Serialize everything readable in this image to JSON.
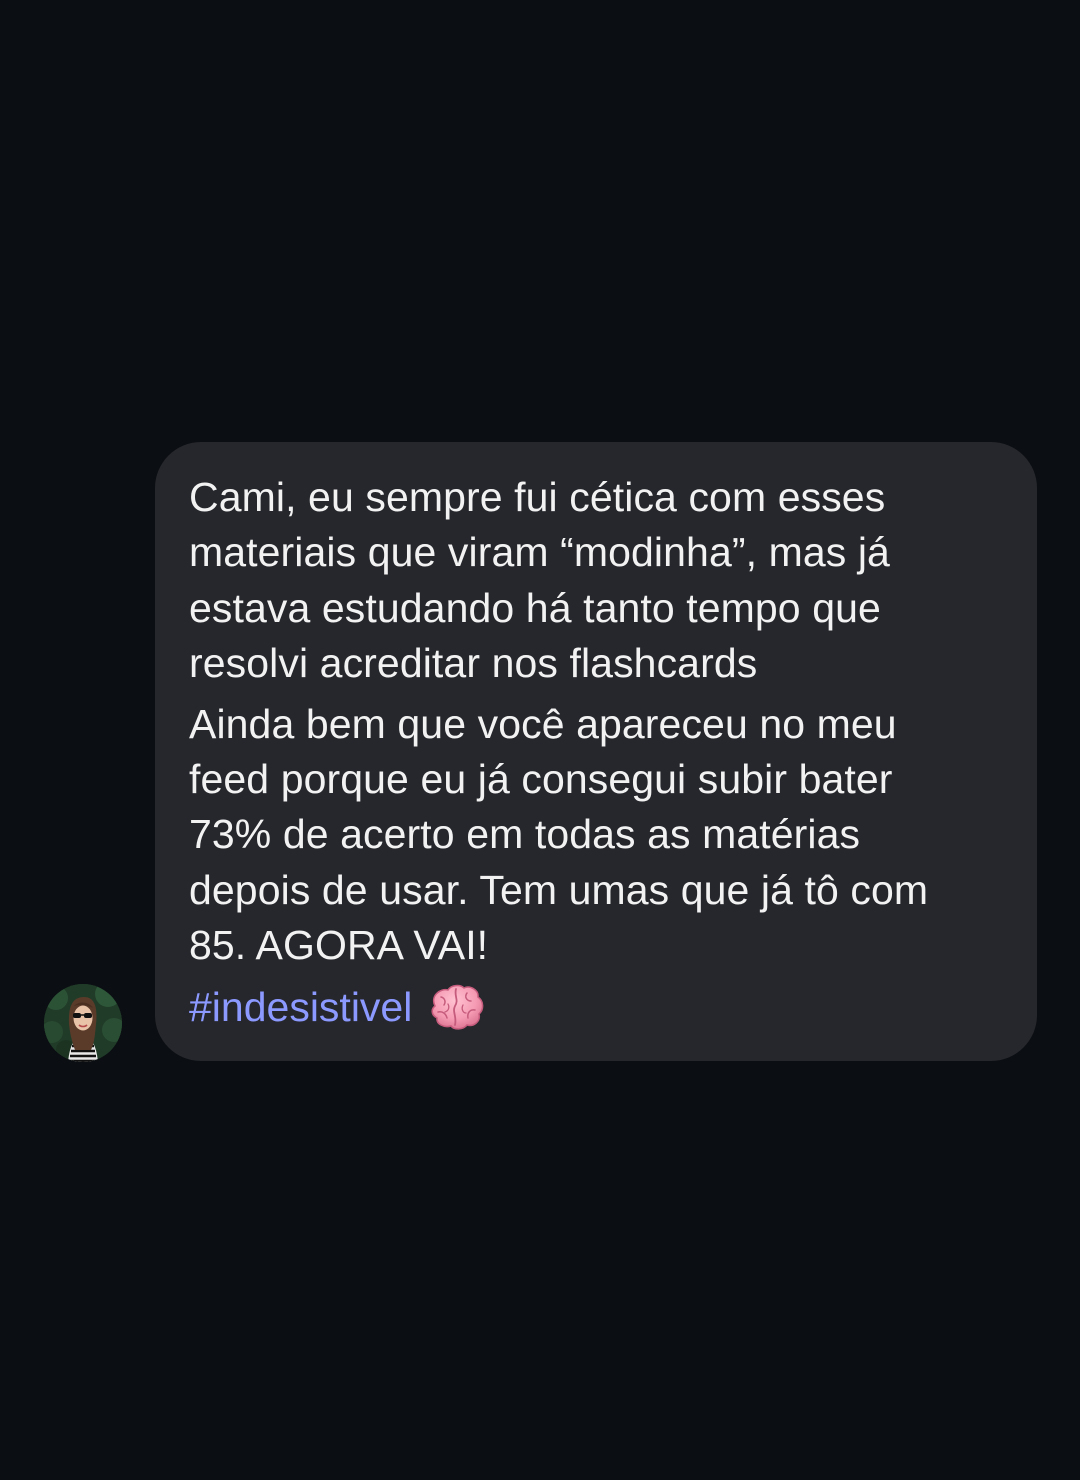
{
  "message": {
    "lines": [
      "Cami, eu sempre fui cética com esses",
      "materiais que viram “modinha”, mas já",
      "estava estudando há tanto tempo que",
      "resolvi acreditar nos flashcards",
      "Ainda bem que você apareceu no meu",
      "feed porque eu já consegui subir bater",
      "73% de acerto em todas as matérias",
      "depois de usar. Tem umas que já tô com",
      "85. AGORA VAI!"
    ],
    "hashtag": "#indesistivel",
    "emoji": "brain-icon"
  },
  "colors": {
    "background": "#0b0e12",
    "bubble": "#25272c",
    "text": "#f2f2f2",
    "hashtag": "#8c99ff"
  }
}
